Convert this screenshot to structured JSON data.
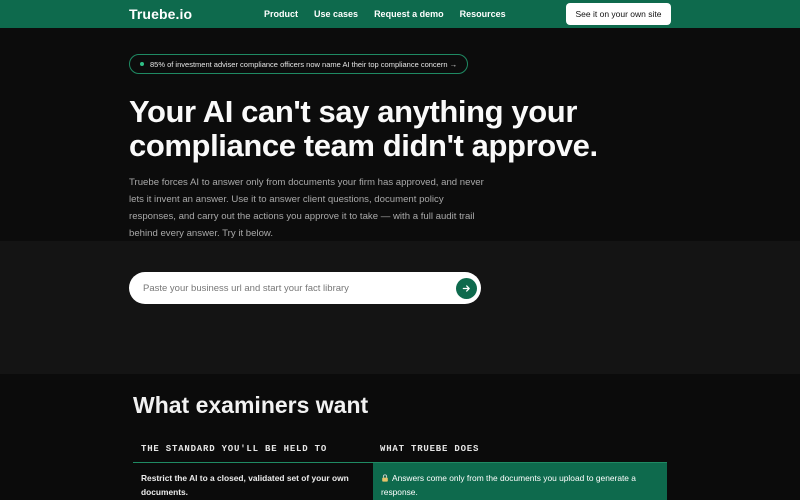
{
  "nav": {
    "logo": "Truebe.io",
    "links": [
      "Product",
      "Use cases",
      "Request a demo",
      "Resources"
    ],
    "cta": "See it on your own site"
  },
  "hero": {
    "pill": "85% of investment adviser compliance officers now name AI their top compliance concern →",
    "headline_line1": "Your AI can't say anything your",
    "headline_line2": "compliance team didn't approve.",
    "subtext": "Truebe forces AI to answer only from documents your firm has approved, and never lets it invent an answer. Use it to answer client questions, document policy responses, and carry out the actions you approve it to take — with a full audit trail behind every answer. Try it below."
  },
  "search": {
    "placeholder": "Paste your business url and start your fact library",
    "value": ""
  },
  "examiners": {
    "title": "What examiners want",
    "col_left": "THE STANDARD YOU'LL BE HELD TO",
    "col_right": "WHAT TRUEBE DOES",
    "rows": [
      {
        "standard": "Restrict the AI to a closed, validated set of your own documents.",
        "truebe": "Answers come only from the documents you upload to generate a response."
      }
    ]
  },
  "colors": {
    "brand_green": "#0e6a4d",
    "accent_green": "#1f8a63",
    "background": "#0b0b0b"
  },
  "icons": {
    "search_submit": "arrow-right-icon",
    "row_marker": "lock-icon"
  }
}
